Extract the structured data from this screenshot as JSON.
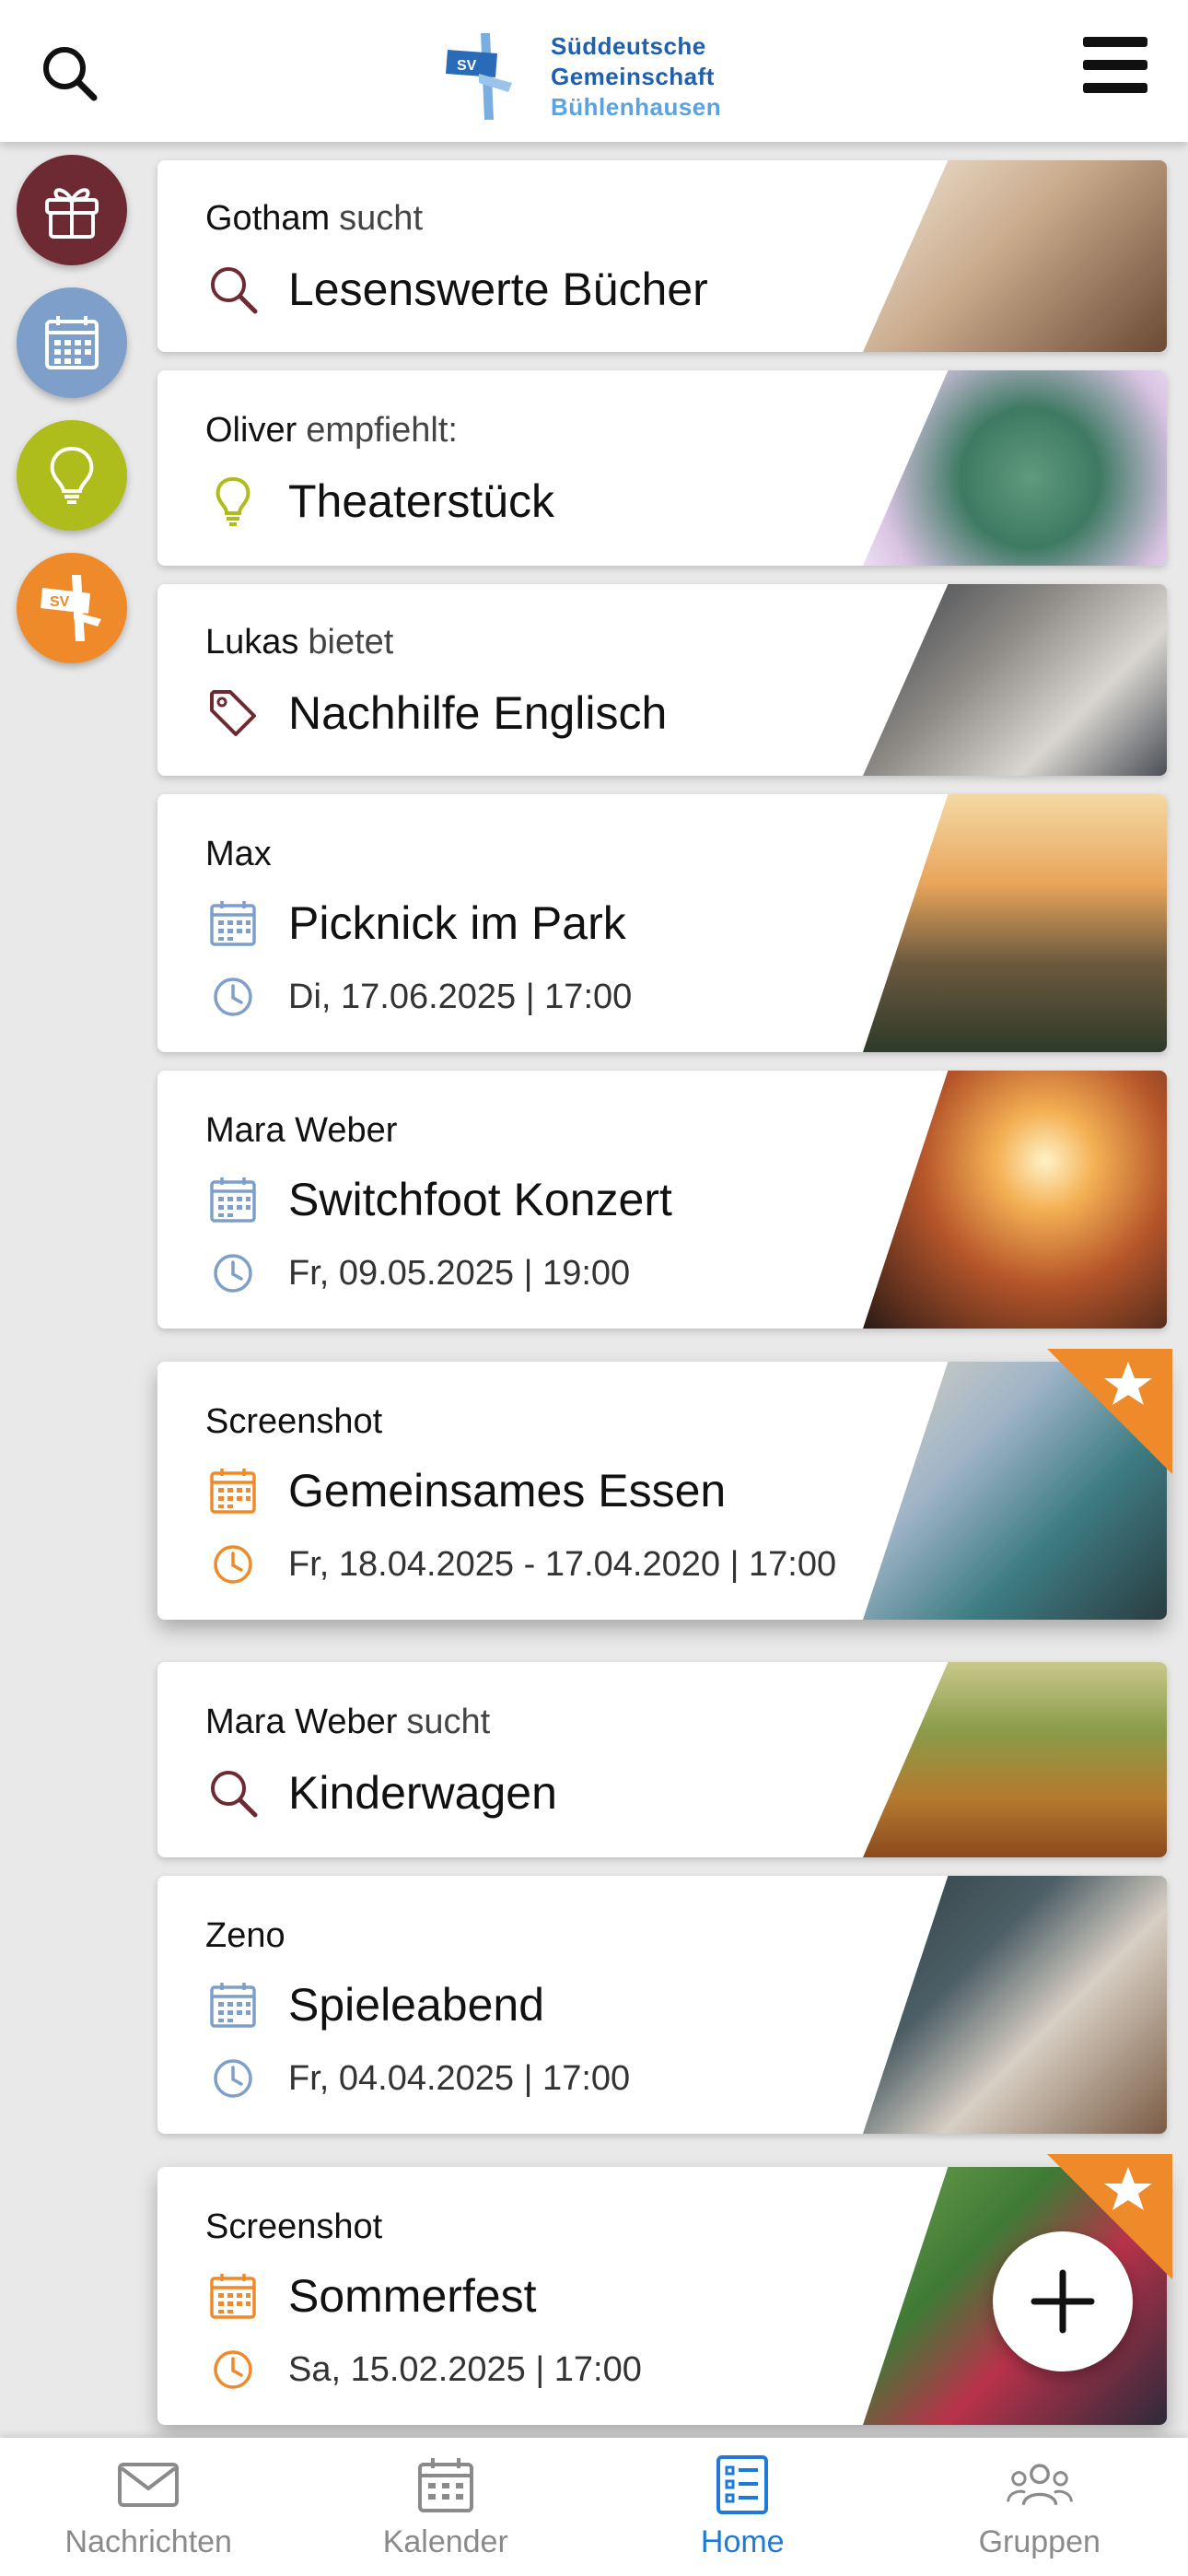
{
  "header": {
    "logo": {
      "line1": "Süddeutsche",
      "line2": "Gemeinschaft",
      "line3": "Bühlenhausen",
      "mark": "SV"
    },
    "search_icon": "search-icon",
    "menu_icon": "hamburger-menu-icon"
  },
  "rail": [
    {
      "name": "gift",
      "color": "#6e2a33"
    },
    {
      "name": "calendar",
      "color": "#7e9fca"
    },
    {
      "name": "idea",
      "color": "#aebd1c"
    },
    {
      "name": "sv",
      "color": "#ef8a2a",
      "label": "SV"
    }
  ],
  "cards": [
    {
      "author": "Gotham",
      "verb": "sucht",
      "title": "Lesenswerte Bücher",
      "icon": "search-icon",
      "icon_color": "#6e2a33"
    },
    {
      "author": "Oliver",
      "verb": "empfiehlt:",
      "title": "Theaterstück",
      "icon": "lightbulb-icon",
      "icon_color": "#aebd1c"
    },
    {
      "author": "Lukas",
      "verb": "bietet",
      "title": "Nachhilfe Englisch",
      "icon": "tag-icon",
      "icon_color": "#6e2a33"
    },
    {
      "author": "Max",
      "verb": "",
      "title": "Picknick im Park",
      "date": "Di, 17.06.2025 | 17:00",
      "icon": "calendar-icon",
      "icon_color": "#7e9fca"
    },
    {
      "author": "Mara Weber",
      "verb": "",
      "title": "Switchfoot Konzert",
      "date": "Fr, 09.05.2025 | 19:00",
      "icon": "calendar-icon",
      "icon_color": "#7e9fca"
    },
    {
      "author": "Screenshot",
      "verb": "",
      "title": "Gemeinsames Essen",
      "date": "Fr, 18.04.2025 - 17.04.2020 | 17:00",
      "icon": "calendar-icon",
      "icon_color": "#ef8a2a",
      "featured": true
    },
    {
      "author": "Mara Weber",
      "verb": "sucht",
      "title": "Kinderwagen",
      "icon": "search-icon",
      "icon_color": "#6e2a33"
    },
    {
      "author": "Zeno",
      "verb": "",
      "title": "Spieleabend",
      "date": "Fr, 04.04.2025 | 17:00",
      "icon": "calendar-icon",
      "icon_color": "#7e9fca"
    },
    {
      "author": "Screenshot",
      "verb": "",
      "title": "Sommerfest",
      "date": "Sa, 15.02.2025 | 17:00",
      "icon": "calendar-icon",
      "icon_color": "#ef8a2a",
      "featured": true
    }
  ],
  "fab": {
    "icon": "plus-icon"
  },
  "nav": [
    {
      "label": "Nachrichten",
      "icon": "mail-icon"
    },
    {
      "label": "Kalender",
      "icon": "calendar-icon"
    },
    {
      "label": "Home",
      "icon": "list-icon",
      "active": true
    },
    {
      "label": "Gruppen",
      "icon": "group-icon"
    }
  ]
}
